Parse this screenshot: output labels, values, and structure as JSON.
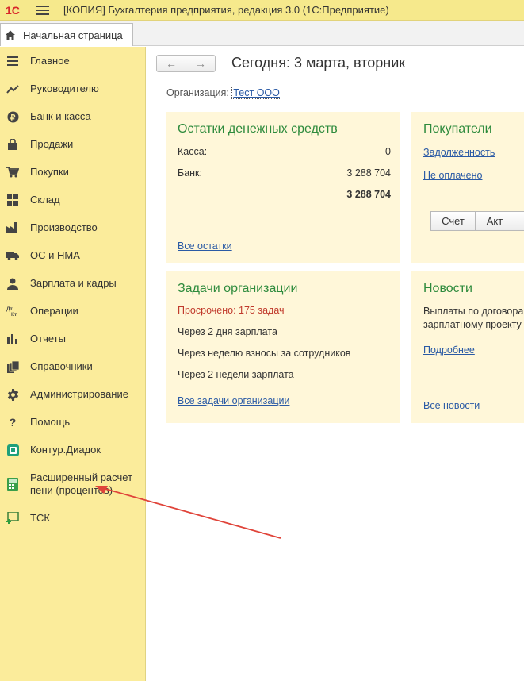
{
  "window": {
    "title": "[КОПИЯ] Бухгалтерия предприятия, редакция 3.0  (1С:Предприятие)",
    "logo_text": "1С"
  },
  "tabs": [
    {
      "label": "Начальная страница"
    }
  ],
  "sidebar": {
    "items": [
      {
        "label": "Главное",
        "icon": "hamburger-icon"
      },
      {
        "label": "Руководителю",
        "icon": "trend-up-icon"
      },
      {
        "label": "Банк и касса",
        "icon": "ruble-icon"
      },
      {
        "label": "Продажи",
        "icon": "shopping-bag-icon"
      },
      {
        "label": "Покупки",
        "icon": "cart-icon"
      },
      {
        "label": "Склад",
        "icon": "warehouse-grid-icon"
      },
      {
        "label": "Производство",
        "icon": "factory-icon"
      },
      {
        "label": "ОС и НМА",
        "icon": "truck-icon"
      },
      {
        "label": "Зарплата и кадры",
        "icon": "person-icon"
      },
      {
        "label": "Операции",
        "icon": "dt-kt-icon"
      },
      {
        "label": "Отчеты",
        "icon": "bar-chart-icon"
      },
      {
        "label": "Справочники",
        "icon": "books-icon"
      },
      {
        "label": "Администрирование",
        "icon": "gear-icon"
      },
      {
        "label": "Помощь",
        "icon": "question-icon"
      },
      {
        "label": "Контур.Диадок",
        "icon": "diadoc-icon"
      },
      {
        "label": "Расширенный расчет пени (процентов)",
        "label_line1": "Расширенный расчет",
        "label_line2": "пени (процентов)",
        "icon": "calculator-icon"
      },
      {
        "label": "ТСК",
        "icon": "tsk-icon"
      }
    ]
  },
  "main": {
    "title": "Сегодня: 3 марта, вторник",
    "org_label": "Организация:",
    "org_value": "Тест ООО",
    "cash_panel": {
      "title": "Остатки денежных средств",
      "rows": [
        {
          "label": "Касса:",
          "value": "0"
        },
        {
          "label": "Банк:",
          "value": "3 288 704"
        }
      ],
      "total": "3 288 704",
      "link": "Все остатки"
    },
    "buyers_panel": {
      "title": "Покупатели",
      "links": [
        "Задолженность",
        "Не оплачено"
      ],
      "buttons": [
        "Счет",
        "Акт"
      ]
    },
    "tasks_panel": {
      "title": "Задачи организации",
      "overdue": "Просрочено: 175 задач",
      "items": [
        "Через 2 дня зарплата",
        "Через неделю взносы за сотрудников",
        "Через 2 недели зарплата"
      ],
      "link": "Все задачи организации"
    },
    "news_panel": {
      "title": "Новости",
      "text_line1": "Выплаты по договора",
      "text_line2": "зарплатному проекту",
      "more_link": "Подробнее",
      "all_link": "Все новости"
    }
  },
  "colors": {
    "sidebar_bg": "#fbec9b",
    "titlebar_bg": "#f6e98c",
    "panel_bg": "#fff7d9",
    "panel_title": "#2e8b3d",
    "link": "#2a5aa5",
    "overdue": "#c0392b",
    "annotation_arrow": "#e0443a",
    "logo_red": "#d8262a"
  }
}
